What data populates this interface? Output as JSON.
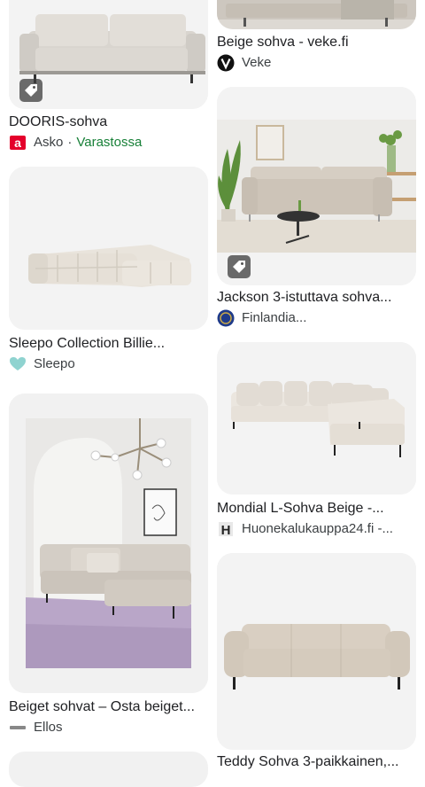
{
  "results": {
    "left": [
      {
        "title": "DOORIS-sohva",
        "source": "Asko",
        "stock": "Varastossa"
      },
      {
        "title": "Sleepo Collection Billie...",
        "source": "Sleepo"
      },
      {
        "title": "Beiget sohvat – Osta beiget...",
        "source": "Ellos"
      }
    ],
    "right": [
      {
        "title": "Beige sohva - veke.fi",
        "source": "Veke"
      },
      {
        "title": "Jackson 3-istuttava sohva...",
        "source": "Finlandia..."
      },
      {
        "title": "Mondial L-Sohva Beige -...",
        "source": "Huonekalukauppa24.fi -..."
      },
      {
        "title": "Teddy Sohva 3-paikkainen,..."
      }
    ]
  },
  "stock_separator": "·",
  "favicons": {
    "asko": "red A logo",
    "sleepo": "teal heart",
    "ellos": "ellos wordmark",
    "veke": "black circle V",
    "finlandia": "blue round seal",
    "huonekalukauppa24": "black H"
  },
  "colors": {
    "stock_green": "#188038",
    "asko_red": "#e4002b",
    "sleepo_teal": "#8fd3d0"
  }
}
